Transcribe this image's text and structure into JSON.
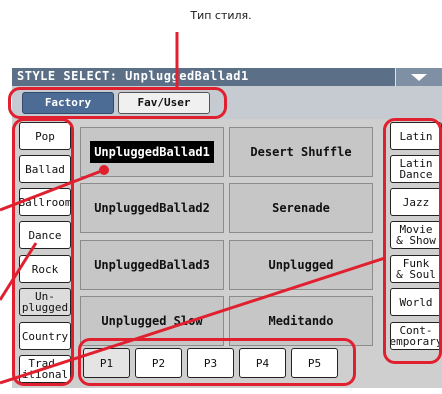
{
  "caption": "Тип стиля.",
  "window": {
    "title": "STYLE SELECT: UnpluggedBallad1"
  },
  "tabs": [
    {
      "label": "Factory"
    },
    {
      "label": "Fav/User"
    }
  ],
  "left_categories": [
    {
      "label": "Pop"
    },
    {
      "label": "Ballad"
    },
    {
      "label": "Ballroom"
    },
    {
      "label": "Dance"
    },
    {
      "label": "Rock"
    },
    {
      "label": "Un-\nplugged"
    },
    {
      "label": "Country"
    },
    {
      "label": "Trad-\nitional"
    }
  ],
  "right_categories": [
    {
      "label": "Latin"
    },
    {
      "label": "Latin\nDance"
    },
    {
      "label": "Jazz"
    },
    {
      "label": "Movie\n& Show"
    },
    {
      "label": "Funk\n& Soul"
    },
    {
      "label": "World"
    },
    {
      "label": "Cont-\nemporary"
    }
  ],
  "styles": [
    {
      "label": "UnpluggedBallad1"
    },
    {
      "label": "Desert Shuffle"
    },
    {
      "label": "UnpluggedBallad2"
    },
    {
      "label": "Serenade"
    },
    {
      "label": "UnpluggedBallad3"
    },
    {
      "label": "Unplugged"
    },
    {
      "label": "Unplugged Slow"
    },
    {
      "label": "Meditando"
    }
  ],
  "pages": [
    {
      "label": "P1"
    },
    {
      "label": "P2"
    },
    {
      "label": "P3"
    },
    {
      "label": "P4"
    },
    {
      "label": "P5"
    }
  ],
  "colors": {
    "title_bar": "#5b6f86",
    "active_tab": "#4c6c96",
    "callout": "#e0202e",
    "selected_style": "#000000"
  }
}
